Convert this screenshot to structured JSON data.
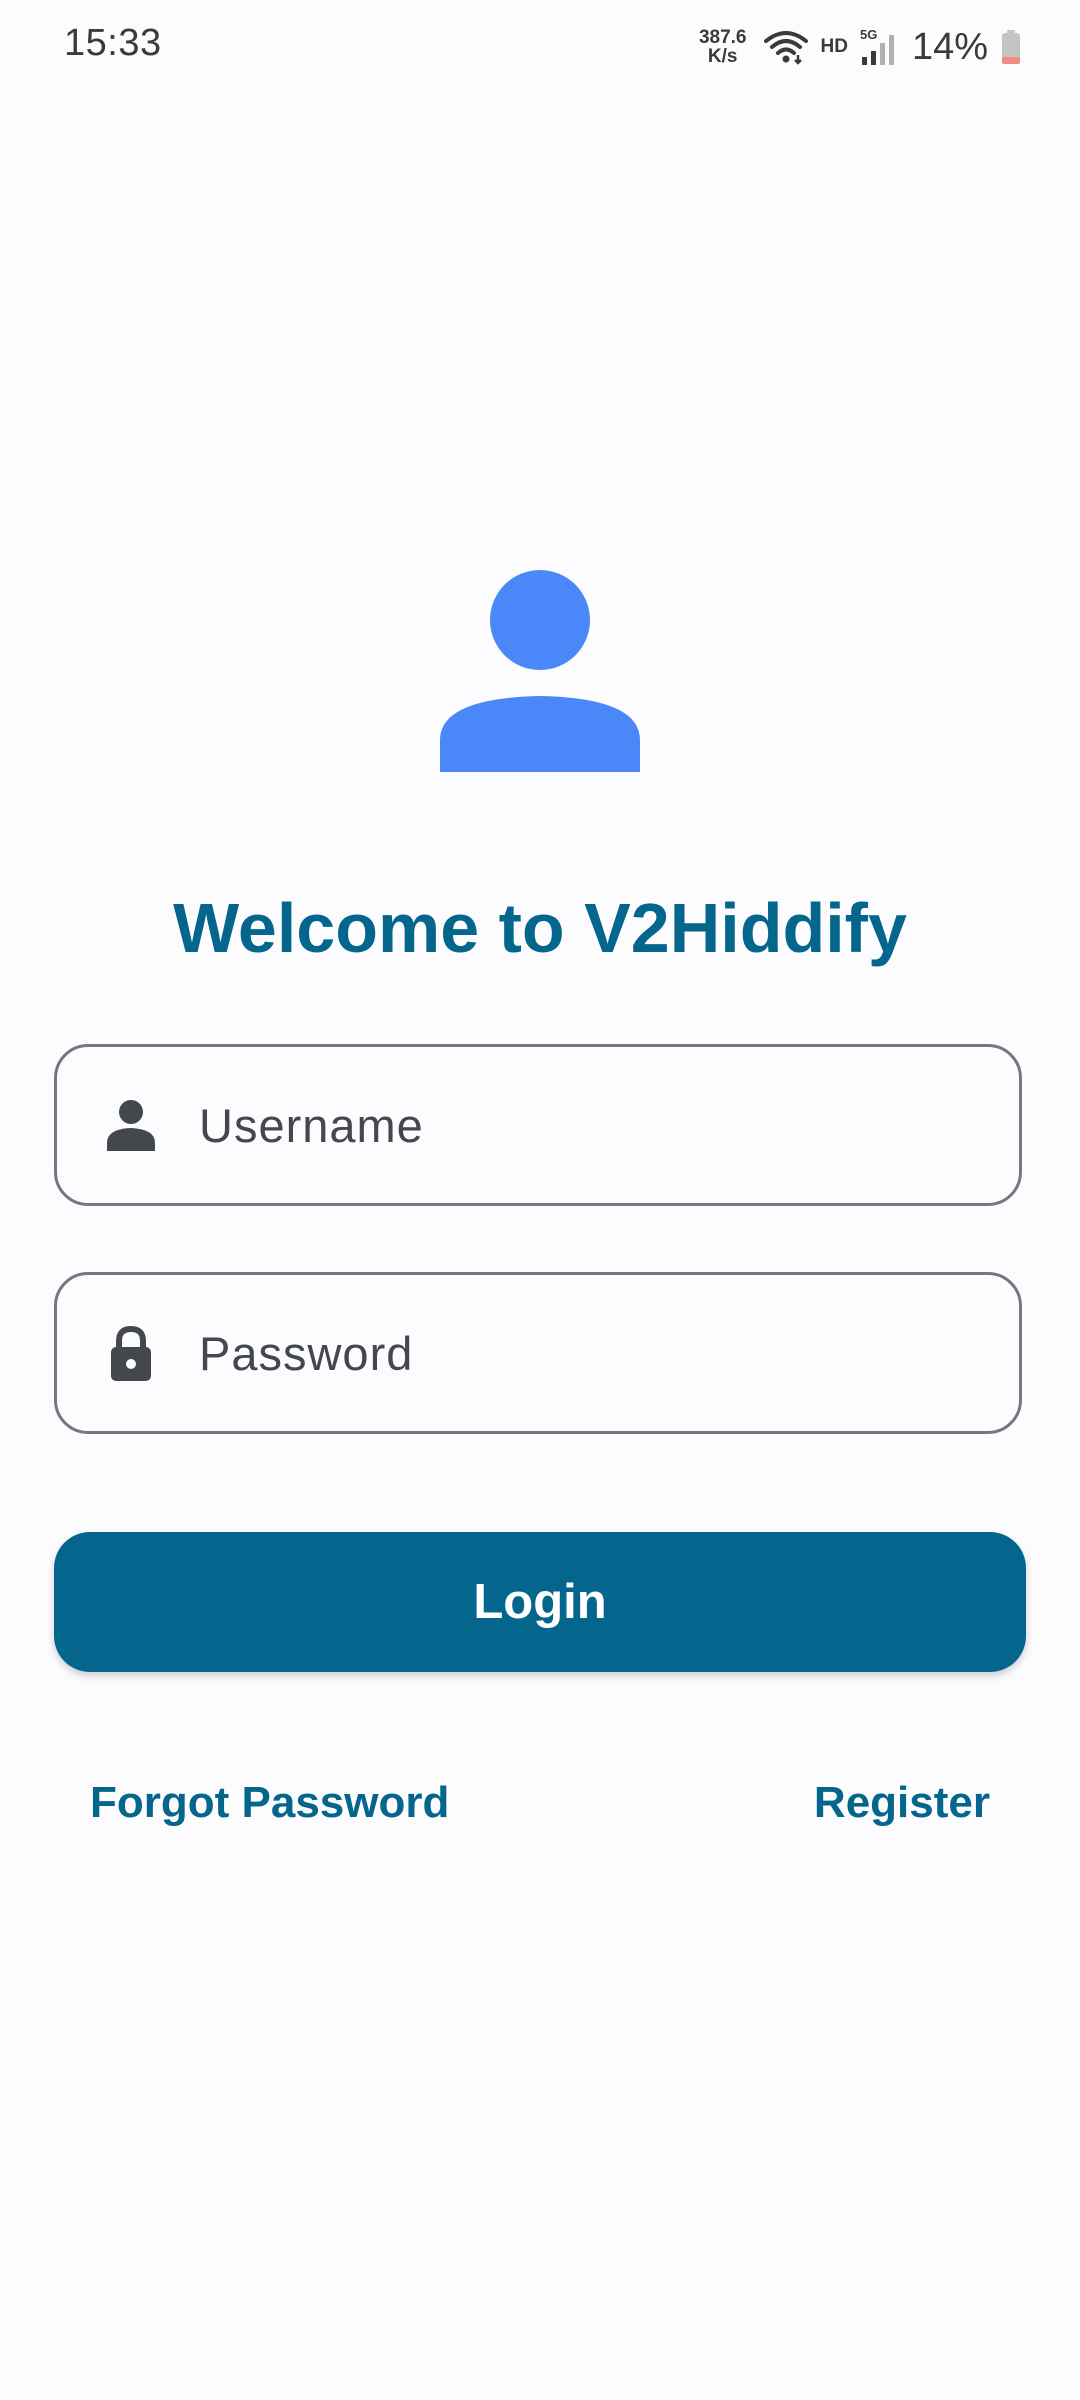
{
  "status_bar": {
    "time": "15:33",
    "net_speed_value": "387.6",
    "net_speed_unit": "K/s",
    "hd_label": "HD",
    "network_label": "5G",
    "battery_percent": "14%",
    "icons": [
      "wifi-icon",
      "signal-icon",
      "battery-icon"
    ]
  },
  "login": {
    "avatar_icon": "person-icon",
    "title": "Welcome to V2Hiddify",
    "username": {
      "icon": "person-icon",
      "placeholder": "Username",
      "value": ""
    },
    "password": {
      "icon": "lock-icon",
      "placeholder": "Password",
      "value": ""
    },
    "login_label": "Login",
    "forgot_password_label": "Forgot Password",
    "register_label": "Register"
  },
  "colors": {
    "primary": "#05668d",
    "avatar": "#4a88fa",
    "background": "#fcfcff",
    "outline": "#73777f",
    "icon": "#43474e",
    "battery_low": "#f28b82"
  }
}
